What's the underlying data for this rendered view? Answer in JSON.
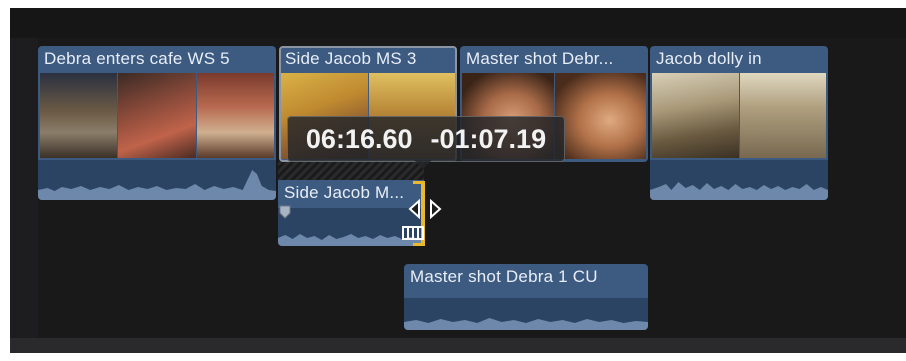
{
  "timeline": {
    "tooltip": {
      "position": "06:16.60",
      "delta": "-01:07.19"
    },
    "clips": [
      {
        "title": "Debra enters cafe WS 5"
      },
      {
        "title": "Side Jacob MS 3"
      },
      {
        "title": "Master shot Debr..."
      },
      {
        "title": "Jacob dolly in"
      },
      {
        "title": "Side Jacob M..."
      },
      {
        "title": "Master shot Debra 1 CU"
      }
    ]
  },
  "colors": {
    "clip": "#3d5a80",
    "waveform": "#2c4463",
    "trim_handle": "#e9b82c",
    "background": "#1d1d1f"
  },
  "icons": [
    "trim-cursor-icon",
    "roll-edit-icon",
    "marker-icon"
  ]
}
